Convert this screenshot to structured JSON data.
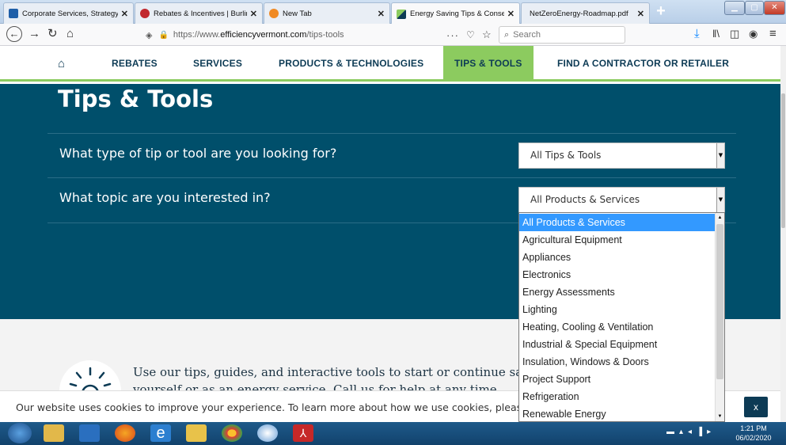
{
  "browser": {
    "tabs": [
      {
        "title": "Corporate Services, Strategy, R",
        "close": "✕"
      },
      {
        "title": "Rebates & Incentives | Burlingt",
        "close": "✕"
      },
      {
        "title": "New Tab",
        "close": "✕"
      },
      {
        "title": "Energy Saving Tips & Conserv",
        "close": "✕"
      },
      {
        "title": "NetZeroEnergy-Roadmap.pdf",
        "close": "✕"
      }
    ],
    "new_tab": "+",
    "url": "https://www.efficiencyvermont.com/tips-tools",
    "url_domain": "efficiencyvermont.com",
    "url_prefix": "https://www.",
    "url_path": "/tips-tools",
    "search_placeholder": "Search",
    "page_actions": "···"
  },
  "site_nav": {
    "items": [
      "REBATES",
      "SERVICES",
      "PRODUCTS & TECHNOLOGIES",
      "TIPS & TOOLS",
      "FIND A CONTRACTOR OR RETAILER"
    ],
    "active": "TIPS & TOOLS"
  },
  "hero": {
    "title": "Tips & Tools",
    "question1": "What type of tip or tool are you looking for?",
    "select1_value": "All Tips & Tools",
    "question2": "What topic are you interested in?",
    "select2_value": "All Products & Services"
  },
  "dropdown": {
    "options": [
      "All Products & Services",
      "Agricultural Equipment",
      "Appliances",
      "Electronics",
      "Energy Assessments",
      "Lighting",
      "Heating, Cooling & Ventilation",
      "Industrial & Special Equipment",
      "Insulation, Windows & Doors",
      "Project Support",
      "Refrigeration",
      "Renewable Energy"
    ],
    "selected": "All Products & Services"
  },
  "lower": {
    "line1": "Use our tips, guides, and interactive tools to start or continue saving ener",
    "line2": "yourself or as an energy service. Call us for help at any time."
  },
  "cookie": {
    "text": "Our website uses cookies to improve your experience. To learn more about how we use cookies, please review o",
    "close": "x"
  },
  "taskbar": {
    "time": "1:21 PM",
    "date": "06/02/2020"
  },
  "colors": {
    "hero_bg": "#004f6b",
    "accent_green": "#8ccb5f",
    "nav_text": "#0d3b55",
    "selected_option": "#3399ff"
  }
}
